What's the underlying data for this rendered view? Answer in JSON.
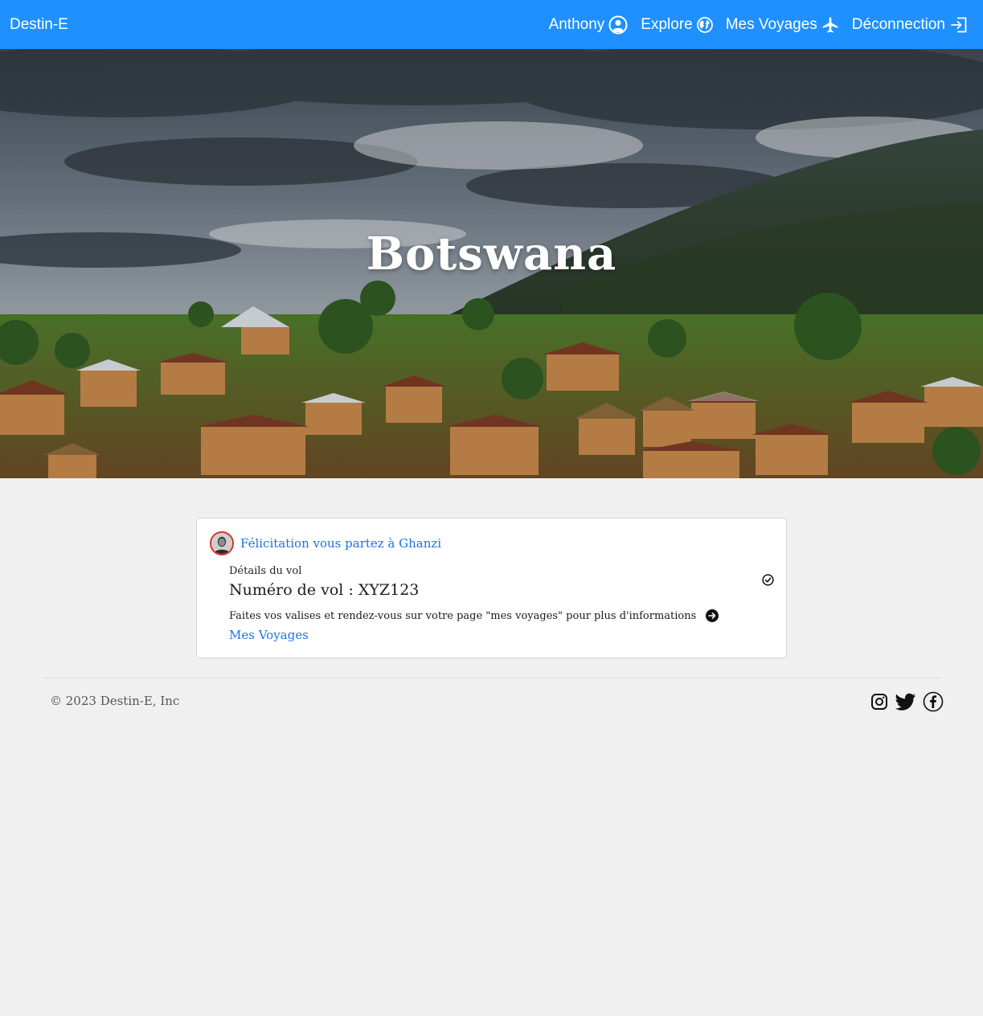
{
  "nav": {
    "brand": "Destin-E",
    "user": "Anthony",
    "explore": "Explore",
    "trips": "Mes Voyages",
    "logout": "Déconnection"
  },
  "hero": {
    "title": "Botswana"
  },
  "card": {
    "headline": "Félicitation vous partez à Ghanzi",
    "flight_label": "Détails du vol",
    "flight_number": "Numéro de vol : XYZ123",
    "info": "Faites vos valises et rendez-vous sur votre page \"mes voyages\" pour plus d'informations",
    "link": "Mes Voyages"
  },
  "footer": {
    "copyright": "© 2023 Destin-E, Inc"
  },
  "colors": {
    "navbar": "#1e90ff",
    "link": "#1a73e8",
    "background": "#f0f0f0"
  }
}
